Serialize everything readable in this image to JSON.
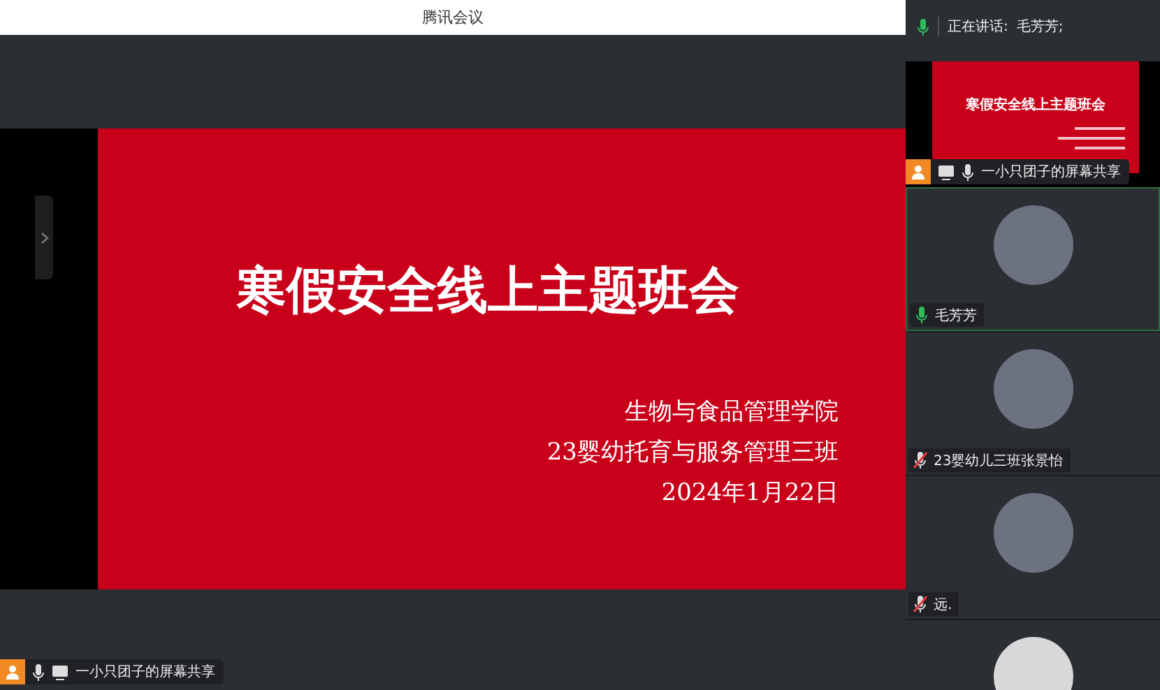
{
  "window": {
    "title": "腾讯会议"
  },
  "speaking_bar": {
    "label": "正在讲话:",
    "names": "毛芳芳;"
  },
  "slide": {
    "title": "寒假安全线上主题班会",
    "lines": [
      "生物与食品管理学院",
      "23婴幼托育与服务管理三班",
      "2024年1月22日"
    ]
  },
  "share_label": {
    "text": "一小只团子的屏幕共享"
  },
  "thumbnail": {
    "slide_title": "寒假安全线上主题班会",
    "label": "一小只团子的屏幕共享"
  },
  "participants": [
    {
      "name": "毛芳芳",
      "muted": false
    },
    {
      "name": "23婴幼儿三班张景怡",
      "muted": true
    },
    {
      "name": "远.",
      "muted": true
    }
  ]
}
